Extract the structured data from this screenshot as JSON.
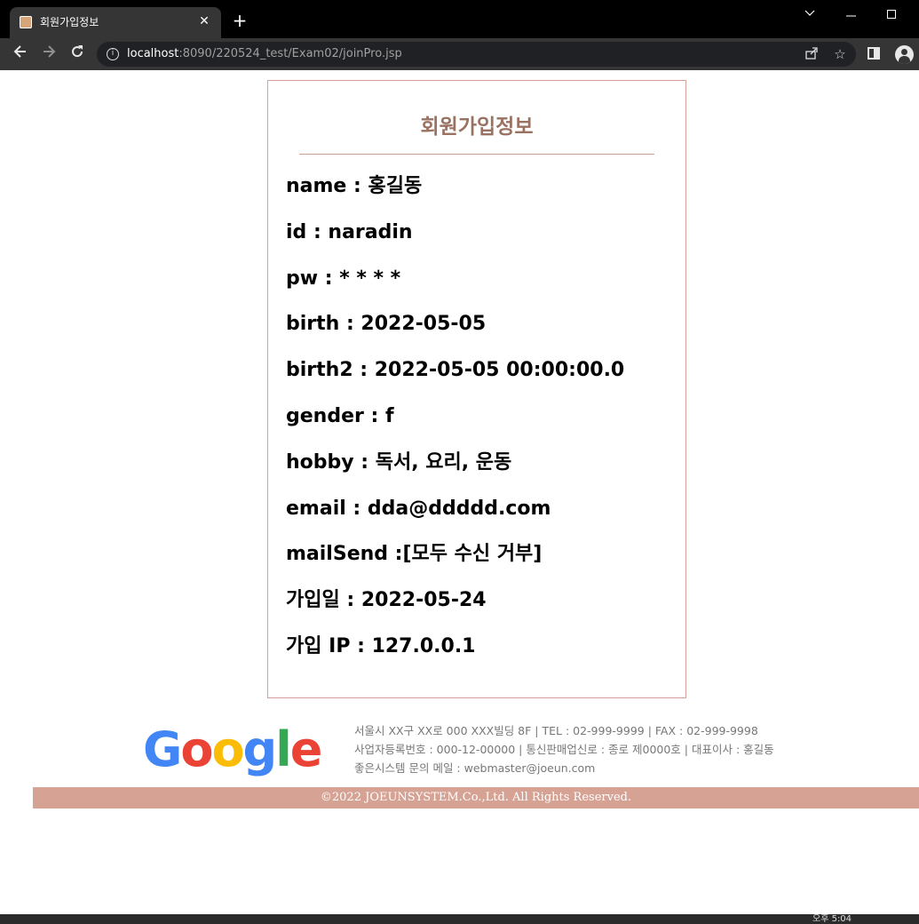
{
  "browser": {
    "tab_title": "회원가입정보",
    "tab_close": "✕",
    "new_tab": "+",
    "url_host": "localhost",
    "url_path": ":8090/220524_test/Exam02/joinPro.jsp",
    "icons": [
      "back-icon",
      "forward-icon",
      "reload-icon",
      "info-icon",
      "share-icon",
      "star-icon",
      "side-panel-icon",
      "profile-icon"
    ]
  },
  "page": {
    "title": "회원가입정보",
    "fields": [
      "name : 홍길동",
      "id : naradin",
      "pw : * * * *",
      "birth : 2022-05-05",
      "birth2 : 2022-05-05 00:00:00.0",
      "gender : f",
      "hobby : 독서, 요리, 운동",
      "email : dda@ddddd.com",
      "mailSend :[모두 수신 거부]",
      "가입일 : 2022-05-24",
      "가입 IP : 127.0.0.1"
    ]
  },
  "footer": {
    "logo_letters": [
      "G",
      "o",
      "o",
      "g",
      "l",
      "e"
    ],
    "info_lines": [
      "서울시 XX구 XX로 000 XXX빌딩 8F | TEL : 02-999-9999 | FAX : 02-999-9998",
      "사업자등록번호 : 000-12-00000 | 통신판매업신로 : 종로 제0000호 | 대표이사 : 홍길동",
      "좋은시스템 문의 메일 : webmaster@joeun.com"
    ],
    "copyright": "©2022 JOEUNSYSTEM.Co.,Ltd. All Rights Reserved."
  },
  "taskbar": {
    "clock": "오후 5:04"
  },
  "colors": {
    "title": "#9a7262",
    "box_border": "#d5a295",
    "copyright_bar": "#d5a294"
  }
}
